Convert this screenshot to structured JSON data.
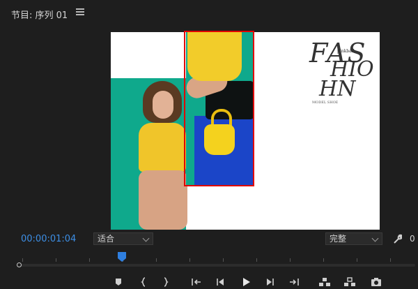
{
  "panel": {
    "title": "节目: 序列 01"
  },
  "viewer": {
    "fashion_text": {
      "line1": "FAS",
      "line2": "HIO",
      "line3": "HN",
      "small": "pinkball",
      "tiny": "MODEL SHOE"
    }
  },
  "controls": {
    "timecode": "00:00:01:04",
    "fit_value": "适合",
    "quality_value": "完整",
    "trailing": "0"
  },
  "colors": {
    "timecode": "#3d8fe6",
    "selection": "#e10000",
    "playhead": "#2f7fe0"
  },
  "transport_icons": [
    "add-marker-icon",
    "mark-in-icon",
    "mark-out-icon",
    "go-to-in-icon",
    "step-back-icon",
    "play-icon",
    "step-forward-icon",
    "go-to-out-icon",
    "lift-icon",
    "extract-icon",
    "export-frame-icon"
  ]
}
